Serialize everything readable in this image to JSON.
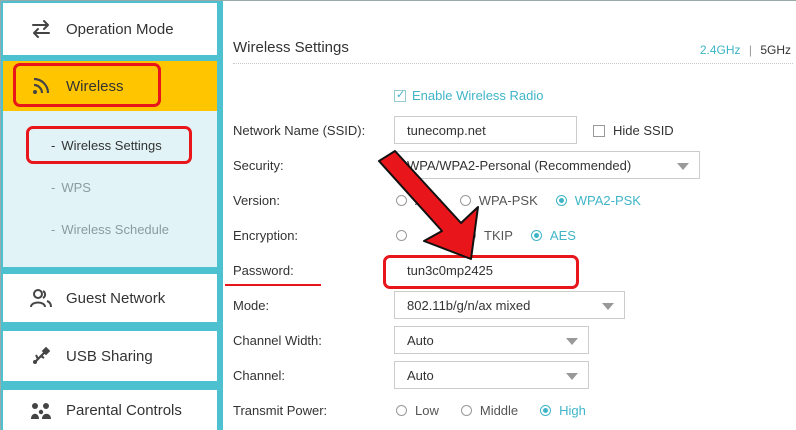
{
  "sidebar": {
    "operation_mode": "Operation Mode",
    "wireless": "Wireless",
    "wireless_settings": "Wireless Settings",
    "wps": "WPS",
    "wireless_schedule": "Wireless Schedule",
    "guest_network": "Guest Network",
    "usb_sharing": "USB Sharing",
    "parental_controls": "Parental Controls",
    "sub_dash": "-"
  },
  "main": {
    "title": "Wireless Settings",
    "band_24": "2.4GHz",
    "band_sep": "|",
    "band_5": "5GHz",
    "enable_radio": "Enable Wireless Radio",
    "ssid_label": "Network Name (SSID):",
    "ssid_value": "tunecomp.net",
    "hide_ssid": "Hide SSID",
    "security_label": "Security:",
    "security_value": "WPA/WPA2-Personal (Recommended)",
    "version_label": "Version:",
    "version_options": [
      "Auto",
      "WPA-PSK",
      "WPA2-PSK"
    ],
    "encryption_label": "Encryption:",
    "encryption_options": [
      "",
      "TKIP",
      "AES"
    ],
    "password_label": "Password:",
    "password_value": "tun3c0mp2425",
    "mode_label": "Mode:",
    "mode_value": "802.11b/g/n/ax mixed",
    "channel_width_label": "Channel Width:",
    "channel_width_value": "Auto",
    "channel_label": "Channel:",
    "channel_value": "Auto",
    "tx_power_label": "Transmit Power:",
    "tx_power_options": [
      "Low",
      "Middle",
      "High"
    ]
  },
  "colors": {
    "accent": "#3fb5c7",
    "sidebar_bg": "#4ec1d0",
    "active_nav": "#ffc600",
    "annotation": "#e8151b"
  }
}
